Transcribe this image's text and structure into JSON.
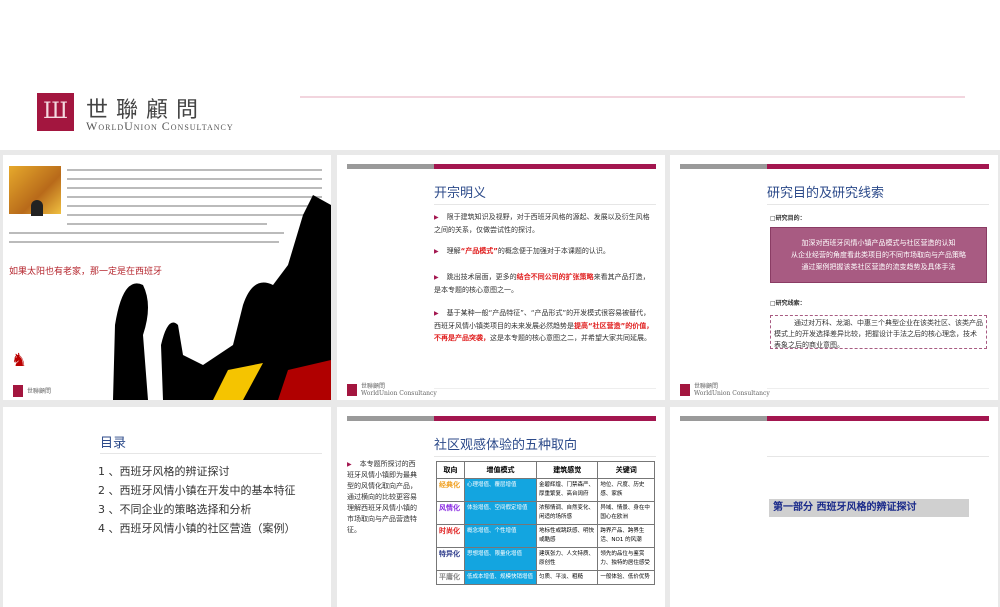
{
  "header": {
    "logo_cn": "世聯顧問",
    "logo_en": "WorldUnion Consultancy"
  },
  "footer_logo": {
    "cn": "世聯顧問",
    "en": "WorldUnion Consultancy"
  },
  "slide1": {
    "slogan": "如果太阳也有老家，那一定是在西班牙"
  },
  "slide2": {
    "title": "开宗明义",
    "bullets": [
      {
        "parts": [
          "限于建筑知识及视野，对于西班牙风格的源起、发展以及衍生风格之间的关系，仅做尝试性的探讨。"
        ]
      },
      {
        "parts": [
          "理解",
          "“产品模式”",
          "的概念便于加强对于本课题的认识。"
        ]
      },
      {
        "parts": [
          "跳出技术层面，更多的",
          "结合不同公司的扩张策略",
          "来看其产品打造，是本专题的核心意图之一。"
        ]
      },
      {
        "parts": [
          "基于某种一般“产品特征”、“产品形式”的开发模式很容易被替代，西班牙风情小镇类项目的未来发展必然趋势是",
          "提高“社区营造”的价值，不再是产品突袭，",
          "这是本专题的核心意图之二，并希望大家共同延展。"
        ]
      }
    ]
  },
  "slide3": {
    "title": "研究目的及研究线索",
    "purpose_label": "□研究目的：",
    "purposes": [
      "加深对西班牙风情小镇产品模式与社区营造的认知",
      "从企业经营的角度看此类项目的不同市场取向与产品策略",
      "通过案例把握该类社区营造的流变趋势及具体手法"
    ],
    "clue_label": "□研究线索：",
    "clue": "通过对万科、龙湖、中惠三个典型企业在该类社区、该类产品模式上的开发选择差异比较，把握设计手法之后的核心理念，技术表象之后的商业意图。"
  },
  "slide4": {
    "title": "目录",
    "items": [
      "1 、西班牙风格的辨证探讨",
      "2 、西班牙风情小镇在开发中的基本特征",
      "3 、不同企业的策略选择和分析",
      "4 、西班牙风情小镇的社区营造（案例）"
    ]
  },
  "slide5": {
    "title": "社区观感体验的五种取向",
    "side": "本专题所探讨的西班牙风情小镇即为最典型的风情化取向产品，通过横向的比较更容易理解西班牙风情小镇的市场取向与产品营造特征。",
    "headers": [
      "取向",
      "增值模式",
      "建筑感觉",
      "关键词"
    ],
    "rows": [
      {
        "k": "经典化",
        "color": "#f0a020",
        "m": "心理增值、覆层增值",
        "f": "金碧辉煌、门禁森严、厚重繁复、高台阔府",
        "w": "地位、尺度、历史感、家族"
      },
      {
        "k": "风情化",
        "color": "#8a2be2",
        "m": "体验增值、空间假定增值",
        "f": "浓郁情调、自然变化、闲适的场所感",
        "w": "异域、情景、身在中国心在欧洲"
      },
      {
        "k": "时尚化",
        "color": "#e02020",
        "m": "概念增值、个性增值",
        "f": "地标性或跳跃感、明快或酷感",
        "w": "跨界产品、跨界生活、NO1 的风潮"
      },
      {
        "k": "特异化",
        "color": "#2c3a8a",
        "m": "思想增值、限量化增值",
        "f": "建筑张力、人文特质、原创性",
        "w": "领先的品位与鉴赏力、独特的居住感受"
      },
      {
        "k": "平庸化",
        "color": "#888888",
        "m": "低成本增值、规模快销增值",
        "f": "匀质、平淡、粗糙",
        "w": "一般体验、低价优势"
      }
    ]
  },
  "slide6": {
    "part": "第一部分   西班牙风格的辨证探讨"
  }
}
